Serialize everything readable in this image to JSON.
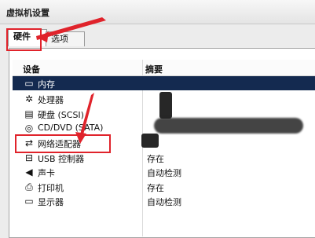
{
  "window": {
    "title": "虚拟机设置"
  },
  "tabs": [
    {
      "label": "硬件",
      "active": true
    },
    {
      "label": "选项",
      "active": false
    }
  ],
  "columns": {
    "device": "设备",
    "summary": "摘要"
  },
  "devices": [
    {
      "icon": "memory-icon",
      "glyph": "▭",
      "label": "内存",
      "summary": "",
      "selected": true
    },
    {
      "icon": "processor-icon",
      "glyph": "✲",
      "label": "处理器",
      "summary": ""
    },
    {
      "icon": "hard-disk-icon",
      "glyph": "▤",
      "label": "硬盘 (SCSI)",
      "summary": ""
    },
    {
      "icon": "cd-dvd-icon",
      "glyph": "◎",
      "label": "CD/DVD (SATA)",
      "summary": ""
    },
    {
      "icon": "network-adapter-icon",
      "glyph": "⇄",
      "label": "网络适配器",
      "summary": ""
    },
    {
      "icon": "usb-controller-icon",
      "glyph": "⊟",
      "label": "USB 控制器",
      "summary": "存在"
    },
    {
      "icon": "sound-card-icon",
      "glyph": "◀",
      "label": "声卡",
      "summary": "自动检测"
    },
    {
      "icon": "printer-icon",
      "glyph": "⎙",
      "label": "打印机",
      "summary": "存在"
    },
    {
      "icon": "display-icon",
      "glyph": "▭",
      "label": "显示器",
      "summary": "自动检测"
    }
  ],
  "colors": {
    "highlight": "#e0232b",
    "selection": "#142a50"
  }
}
